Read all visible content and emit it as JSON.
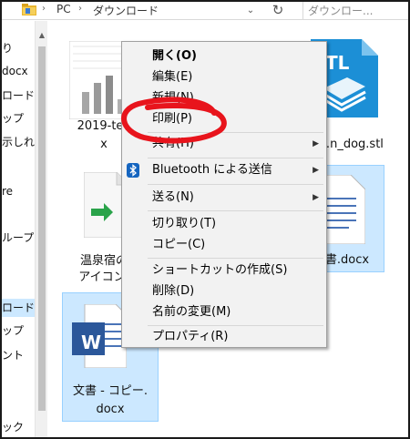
{
  "address_bar": {
    "location": "PC",
    "folder": "ダウンロード",
    "separator_glyph": "›",
    "dropdown_glyph": "⌄",
    "refresh_glyph": "↻"
  },
  "search": {
    "placeholder": "ダウンロー..."
  },
  "nav_pane": {
    "items": [
      "り",
      "docx",
      "ロード",
      "ップ",
      "示しれ",
      "re",
      "ループ",
      "ロード",
      "ップ",
      "ント",
      "ック"
    ],
    "selected_label": "ロード"
  },
  "files": [
    {
      "name_line1": "2019-tee",
      "name_line2": "x",
      "type": "excel-chart-thumbnail"
    },
    {
      "name_line1": "…n_dog.stl",
      "name_line2": "",
      "type": "stl-file"
    },
    {
      "name_line1": "温泉宿の",
      "name_line2": "アイコン.",
      "type": "shortcut"
    },
    {
      "name_line1": "書.docx",
      "name_line2": "",
      "type": "word-doc-selected"
    },
    {
      "name_line1": "文書 - コピー.",
      "name_line2": "docx",
      "type": "word-doc-selected"
    }
  ],
  "stl_badge": "TL",
  "word_badge": "W",
  "context_menu": {
    "items": [
      {
        "label": "開く(O)",
        "bold": true,
        "submenu": false
      },
      {
        "label": "編集(E)",
        "bold": false,
        "submenu": false
      },
      {
        "label": "新規(N)",
        "bold": false,
        "submenu": false
      },
      {
        "label": "印刷(P)",
        "bold": false,
        "submenu": false
      },
      {
        "label": "共有(H)",
        "bold": false,
        "submenu": true
      },
      {
        "label": "Bluetooth による送信",
        "bold": false,
        "submenu": true
      },
      {
        "label": "送る(N)",
        "bold": false,
        "submenu": true
      },
      {
        "label": "切り取り(T)",
        "bold": false,
        "submenu": false
      },
      {
        "label": "コピー(C)",
        "bold": false,
        "submenu": false
      },
      {
        "label": "ショートカットの作成(S)",
        "bold": false,
        "submenu": false
      },
      {
        "label": "削除(D)",
        "bold": false,
        "submenu": false
      },
      {
        "label": "名前の変更(M)",
        "bold": false,
        "submenu": false
      },
      {
        "label": "プロパティ(R)",
        "bold": false,
        "submenu": false
      }
    ],
    "submenu_arrow": "▶"
  },
  "colors": {
    "selection_fill": "#cce8ff",
    "selection_border": "#99d1ff",
    "annotation_red": "#e8141c",
    "word_blue": "#2b579a",
    "stl_blue": "#1c8fd6",
    "excel_green": "#217346"
  }
}
